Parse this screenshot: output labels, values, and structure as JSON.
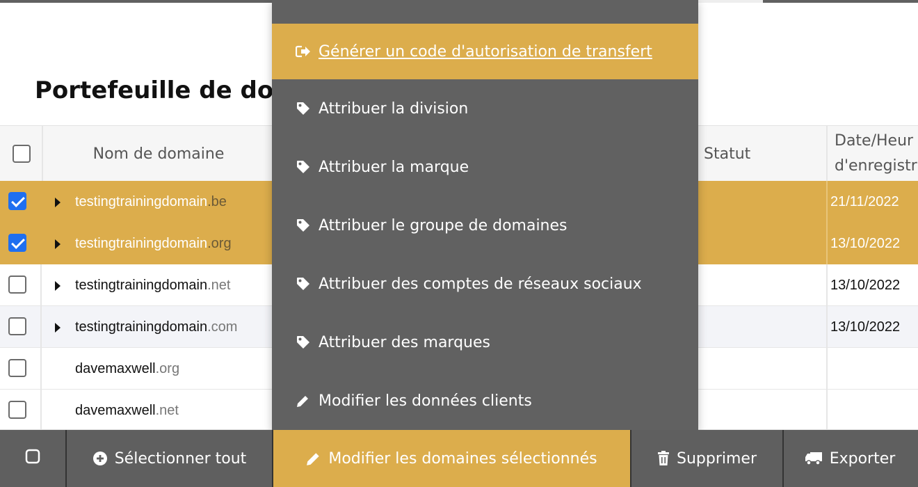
{
  "page": {
    "title": "Portefeuille de dom"
  },
  "table": {
    "headers": {
      "domain": "Nom de domaine",
      "status": "Statut",
      "date": "Date/Heur\nd'enregistr"
    },
    "rows": [
      {
        "base": "testingtrainingdomain",
        "tld": ".be",
        "date": "21/11/2022"
      },
      {
        "base": "testingtrainingdomain",
        "tld": ".org",
        "date": "13/10/2022"
      },
      {
        "base": "testingtrainingdomain",
        "tld": ".net",
        "date": "13/10/2022"
      },
      {
        "base": "testingtrainingdomain",
        "tld": ".com",
        "date": "13/10/2022"
      },
      {
        "base": "davemaxwell",
        "tld": ".org",
        "date": ""
      },
      {
        "base": "davemaxwell",
        "tld": ".net",
        "date": ""
      }
    ]
  },
  "menu": {
    "items": [
      {
        "label": "Générer un code d'autorisation de transfert",
        "icon": "sign-out-icon"
      },
      {
        "label": "Attribuer la division",
        "icon": "tag-icon"
      },
      {
        "label": "Attribuer la marque",
        "icon": "tag-icon"
      },
      {
        "label": "Attribuer le groupe de domaines",
        "icon": "tag-icon"
      },
      {
        "label": "Attribuer des comptes de réseaux sociaux",
        "icon": "tag-icon"
      },
      {
        "label": "Attribuer des marques",
        "icon": "tag-icon"
      },
      {
        "label": "Modifier les données clients",
        "icon": "pencil-icon"
      }
    ]
  },
  "toolbar": {
    "select_all": "Sélectionner tout",
    "edit_selected": "Modifier les domaines sélectionnés",
    "delete": "Supprimer",
    "export": "Exporter"
  },
  "colors": {
    "accent": "#dcad4c",
    "dark": "#616161",
    "checkbox": "#1f6ff0"
  }
}
